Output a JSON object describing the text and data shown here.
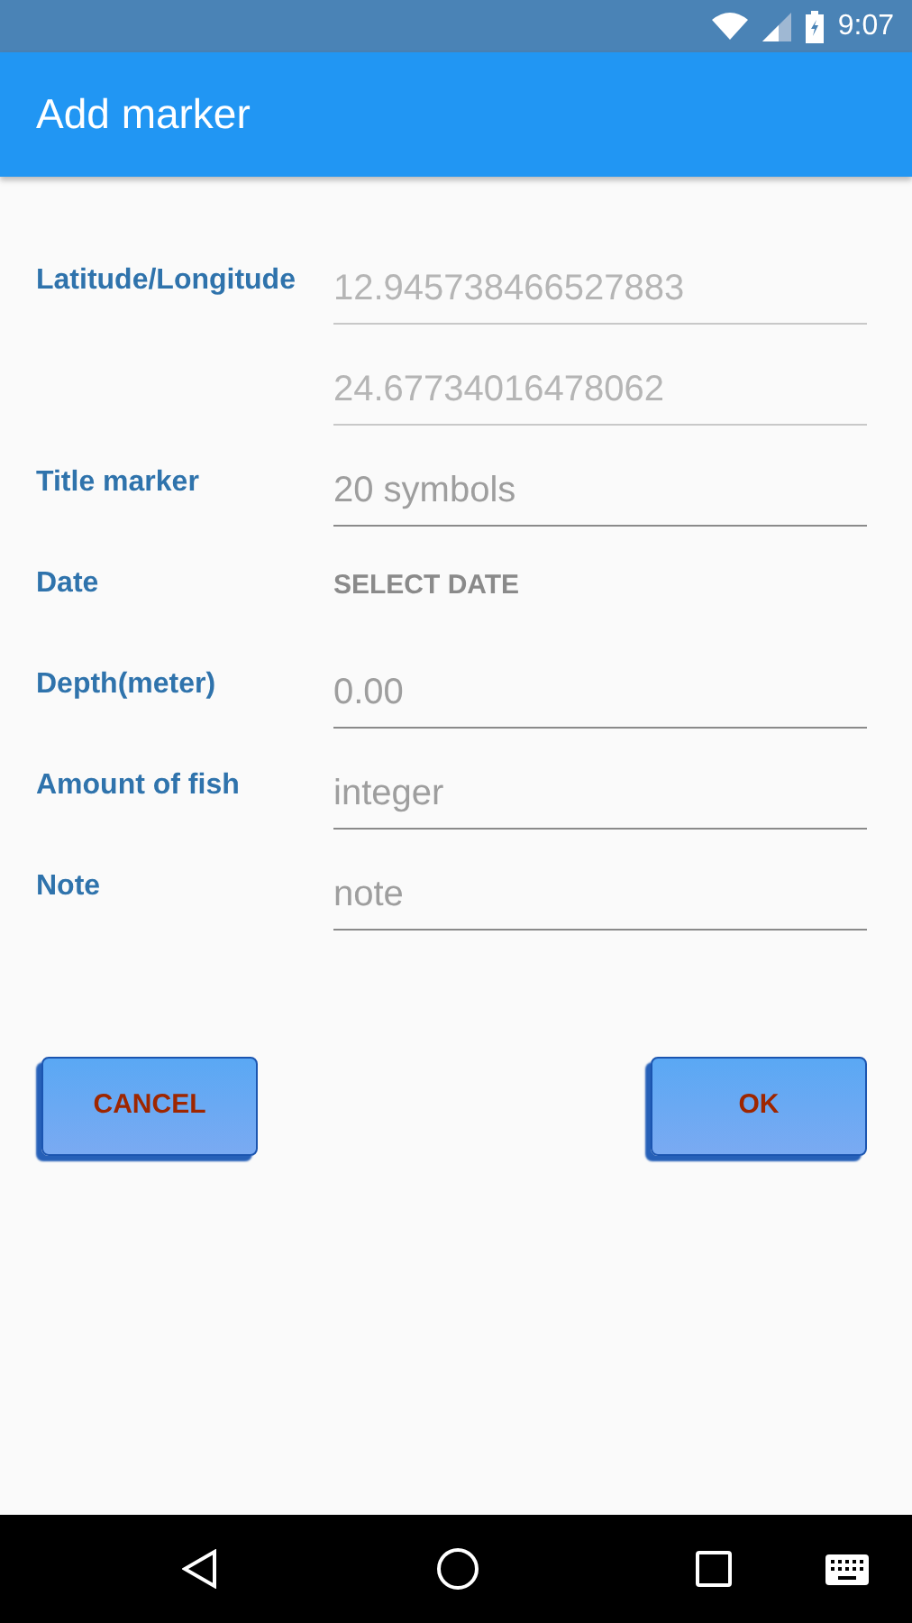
{
  "status_bar": {
    "time": "9:07"
  },
  "app_bar": {
    "title": "Add marker"
  },
  "rows": [
    {
      "label": "Latitude/Longitude",
      "kind": "field",
      "value": "12.945738466527883",
      "disabled": true
    },
    {
      "kind": "field",
      "value": "24.67734016478062",
      "disabled": true
    },
    {
      "label": "Title marker",
      "kind": "field",
      "placeholder": "20 symbols",
      "disabled": false
    },
    {
      "label": "Date",
      "kind": "date_button",
      "button": "SELECT DATE"
    },
    {
      "label": "Depth(meter)",
      "kind": "field",
      "placeholder": "0.00",
      "disabled": false
    },
    {
      "label": "Amount of fish",
      "kind": "field",
      "placeholder": "integer",
      "disabled": false
    },
    {
      "label": "Note",
      "kind": "field",
      "placeholder": "note",
      "disabled": false
    }
  ],
  "buttons": [
    "CANCEL",
    "OK"
  ]
}
